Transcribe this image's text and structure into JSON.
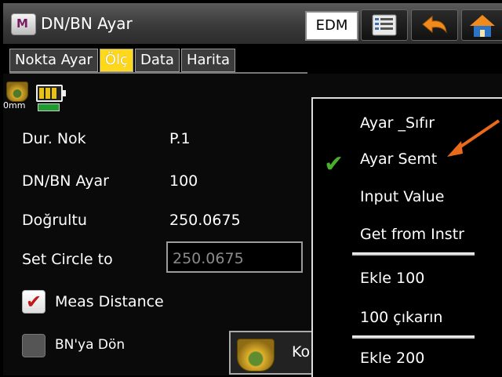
{
  "titlebar": {
    "app_icon_letter": "M",
    "title": "DN/BN Ayar",
    "edm_label": "EDM",
    "icons": [
      "list-icon",
      "back-arrow-icon",
      "home-icon"
    ]
  },
  "tabs": [
    {
      "label": "Nokta Ayar"
    },
    {
      "label": "Ölç"
    },
    {
      "label": "Data"
    },
    {
      "label": "Harita"
    }
  ],
  "status": {
    "prism_label": "0mm"
  },
  "fields": {
    "station_label": "Dur. Nok",
    "station_value": "P.1",
    "dnbn_label": "DN/BN Ayar",
    "dnbn_value": "100",
    "direction_label": "Doğrultu",
    "direction_value": "250.0675",
    "set_circle_label": "Set Circle to",
    "set_circle_value": "250.0675"
  },
  "checkboxes": {
    "meas_distance_label": "Meas Distance",
    "meas_distance_checked": true,
    "bn_return_label": "BN'ya Dön",
    "bn_return_checked": false
  },
  "bottom_button": {
    "label": "Ko"
  },
  "menu": {
    "items": [
      {
        "label": "Ayar _Sıfır"
      },
      {
        "label": "Ayar Semt",
        "checked": true
      },
      {
        "label": "Input Value"
      },
      {
        "label": "Get from Instr"
      },
      {
        "label": "Ekle 100"
      },
      {
        "label": "100 çıkarın"
      },
      {
        "label": "Ekle 200"
      }
    ]
  },
  "colors": {
    "active_tab": "#ffd81a",
    "arrow": "#e86a1a",
    "check": "#49b02a"
  }
}
